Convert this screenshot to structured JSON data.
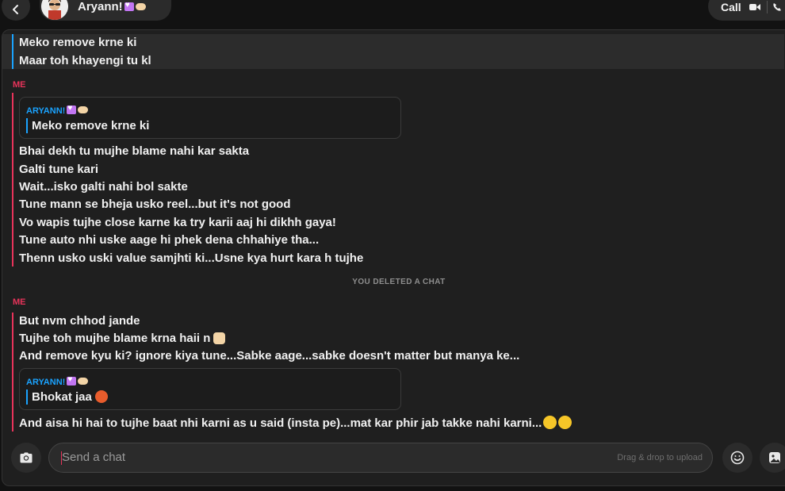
{
  "header": {
    "contact_name": "Aryann!",
    "call_label": "Call"
  },
  "messages": {
    "highlighted": [
      "Meko remove krne ki",
      "Maar toh khayengi tu kl"
    ],
    "group1": {
      "sender": "ME",
      "quote": {
        "name": "ARYANN!",
        "text": "Meko remove krne ki"
      },
      "lines": [
        "Bhai dekh tu mujhe blame nahi kar sakta",
        "Galti tune kari",
        "Wait...isko galti nahi bol sakte",
        "Tune mann se bheja usko reel...but it's not good",
        "Vo wapis tujhe close karne ka try karii aaj hi dikhh gaya!",
        "Tune auto nhi uske aage hi phek dena chhahiye tha...",
        "Thenn usko uski value samjhti ki...Usne kya hurt kara h tujhe"
      ]
    },
    "system_note": "YOU DELETED A CHAT",
    "group2": {
      "sender": "ME",
      "lines": [
        "But nvm chhod jande",
        "Tujhe toh mujhe blame krna haii n",
        "And remove kyu ki? ignore kiya tune...Sabke aage...sabke doesn't matter but manya ke..."
      ],
      "quote": {
        "name": "ARYANN!",
        "text": "Bhokat jaa"
      },
      "last_line": "And aisa hi hai to tujhe baat nhi karni as u said (insta pe)...mat kar phir jab takke nahi karni..."
    }
  },
  "composer": {
    "placeholder": "Send a chat",
    "drag_hint": "Drag & drop to upload"
  },
  "icons": {
    "back": "chevron-left-icon",
    "video": "video-camera-icon",
    "phone": "phone-icon",
    "camera": "camera-icon",
    "emoji": "smiley-icon",
    "sticker": "sticker-icon"
  },
  "colors": {
    "accent_red": "#e8335a",
    "accent_blue": "#1aa3ff",
    "background": "#121212",
    "panel": "#1f1f1f"
  }
}
